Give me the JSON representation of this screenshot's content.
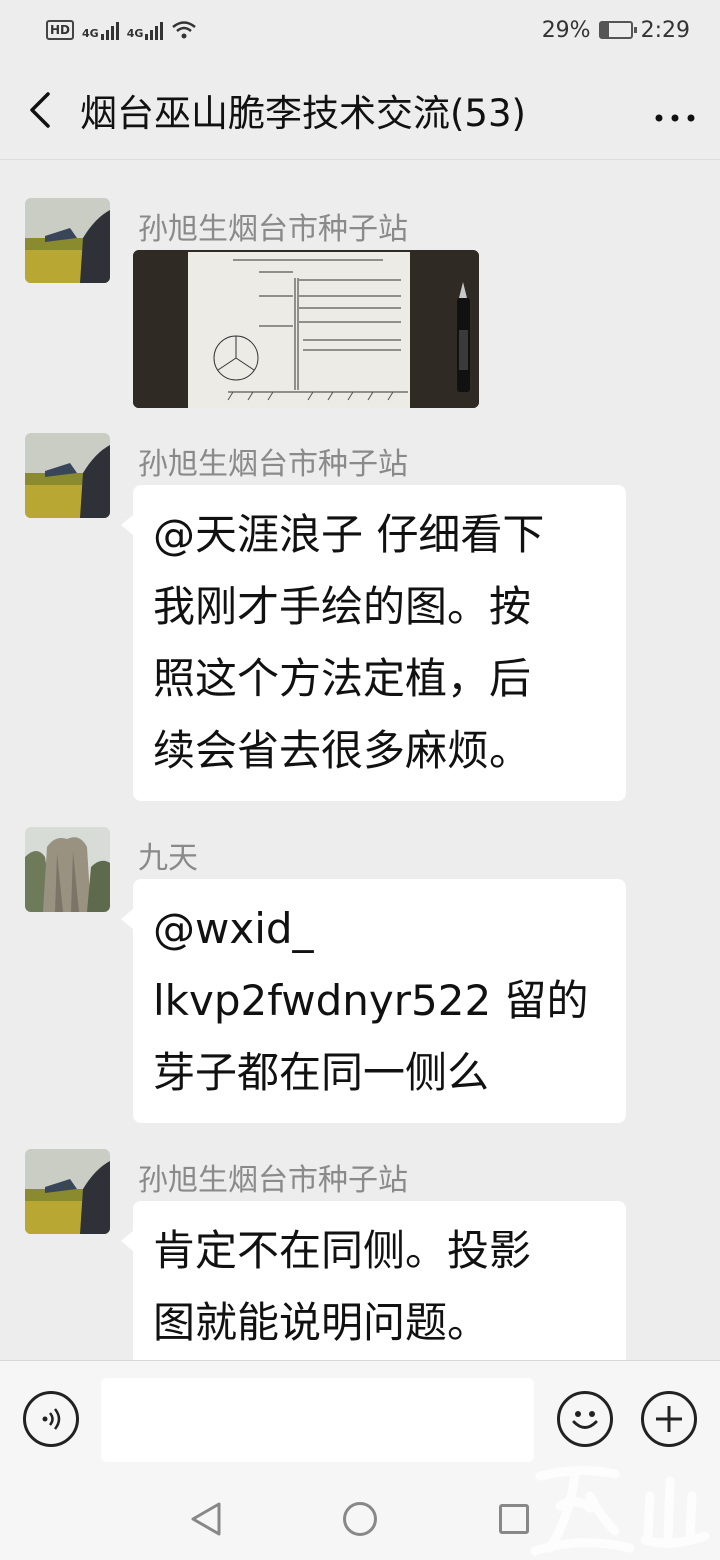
{
  "status_bar": {
    "hd": "HD",
    "net1": "4G",
    "net2": "4G",
    "battery": "29%",
    "battery_level": 0.29,
    "time": "2:29"
  },
  "header": {
    "back_icon": "chevron-left-icon",
    "title": "烟台巫山脆李技术交流(53)",
    "more_icon": "more-dots-icon"
  },
  "messages": [
    {
      "sender": "孙旭生烟台市种子站",
      "type": "image",
      "image_desc": "hand-drawn-diagram-photo"
    },
    {
      "sender": "孙旭生烟台市种子站",
      "type": "text",
      "lines": [
        "@天涯浪子 仔细看下",
        "我刚才手绘的图。按",
        "照这个方法定植，后",
        "续会省去很多麻烦。"
      ]
    },
    {
      "sender": "九天",
      "type": "text",
      "lines": [
        "@wxid_",
        "lkvp2fwdnyr522 留的",
        "芽子都在同一侧么"
      ]
    },
    {
      "sender": "孙旭生烟台市种子站",
      "type": "text",
      "lines": [
        "肯定不在同侧。投影",
        "图就能说明问题。"
      ]
    }
  ],
  "input_bar": {
    "voice_icon": "voice-icon",
    "emoji_icon": "emoji-icon",
    "plus_icon": "plus-icon",
    "placeholder": ""
  },
  "nav_bar": {
    "back_icon": "nav-back-icon",
    "home_icon": "nav-home-icon",
    "recent_icon": "nav-recent-icon"
  }
}
